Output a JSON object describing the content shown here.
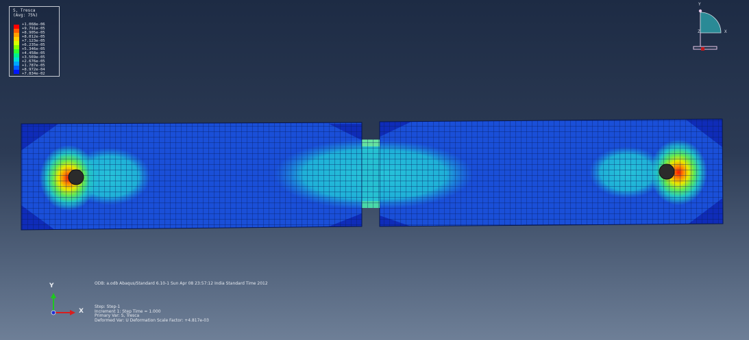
{
  "legend": {
    "title": "S, Tresca",
    "subtitle": "(Avg: 75%)",
    "values": [
      "+1.068e-06",
      "+9.791e-05",
      "+8.905e-05",
      "+8.012e-05",
      "+7.123e-05",
      "+6.235e-05",
      "+5.346e-05",
      "+4.458e-05",
      "+3.569e-05",
      "+2.676e-05",
      "+1.787e-05",
      "+8.972e-04",
      "+7.834e-02"
    ],
    "colors": [
      "#ff0000",
      "#ff5a00",
      "#ffa000",
      "#ffd200",
      "#d8ff00",
      "#86ff00",
      "#2cff30",
      "#00f08c",
      "#00dcd6",
      "#00a6ff",
      "#0060ff",
      "#0016ff"
    ]
  },
  "triad_top": {
    "y": "Y",
    "z": "Z",
    "x": "X"
  },
  "triad_bottom": {
    "y": "Y",
    "x": "X"
  },
  "info": {
    "odb": "ODB: a.odb    Abaqus/Standard 6.10-1    Sun Apr 08 23:57:12 India Standard Time 2012",
    "step": "Step: Step-1",
    "increment": "Increment     1: Step Time =    1.000",
    "primary_var": "Primary Var: S, Tresca",
    "deformed_var": "Deformed Var: U   Deformation Scale Factor: +4.817e-03"
  }
}
